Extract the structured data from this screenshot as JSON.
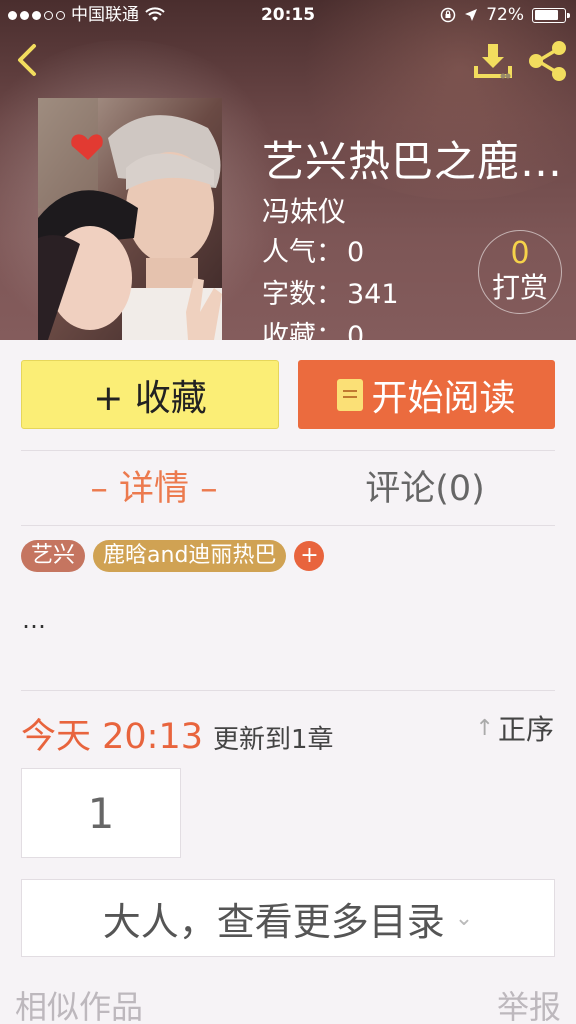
{
  "status_bar": {
    "carrier": "中国联通",
    "time": "20:15",
    "battery": "72%",
    "battery_level": 0.72
  },
  "book": {
    "title": "艺兴热巴之鹿…",
    "author": "冯妹仪",
    "stats": [
      {
        "label": "人气：",
        "value": "0"
      },
      {
        "label": "字数：",
        "value": "341"
      },
      {
        "label": "收藏：",
        "value": "0"
      }
    ],
    "tip": {
      "count": "0",
      "label": "打赏"
    }
  },
  "actions": {
    "collect": "+ 收藏",
    "read": "开始阅读"
  },
  "tabs": {
    "details": "– 详情 –",
    "comments": "评论(0)"
  },
  "tags": [
    "艺兴",
    "鹿晗and迪丽热巴",
    "+"
  ],
  "description": "…",
  "update": {
    "today": "今天 20:13",
    "text": "更新到1章",
    "order": "正序"
  },
  "chapters": [
    "1"
  ],
  "more_catalog": "大人，查看更多目录",
  "footer": {
    "similar": "相似作品",
    "report": "举报"
  },
  "colors": {
    "accent_orange": "#eb6b3e",
    "collect_yellow": "#fbee76",
    "tag_1": "#c57560",
    "tag_2": "#d0a253",
    "tip_count": "#f6d34a"
  },
  "icons": [
    "back-icon",
    "download-icon",
    "share-icon",
    "book-icon",
    "up-arrow-icon",
    "chevron-down-icon"
  ]
}
